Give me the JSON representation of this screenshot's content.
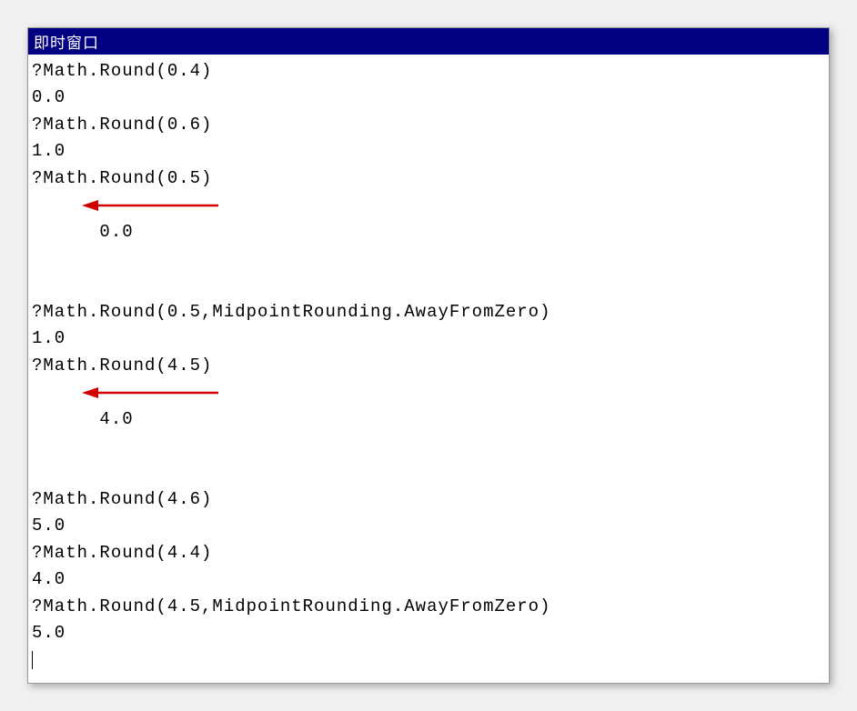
{
  "window": {
    "title": "即时窗口"
  },
  "lines": [
    "?Math.Round(0.4)",
    "0.0",
    "?Math.Round(0.6)",
    "1.0",
    "?Math.Round(0.5)",
    "0.0",
    "?Math.Round(0.5,MidpointRounding.AwayFromZero)",
    "1.0",
    "?Math.Round(4.5)",
    "4.0",
    "?Math.Round(4.6)",
    "5.0",
    "?Math.Round(4.4)",
    "4.0",
    "?Math.Round(4.5,MidpointRounding.AwayFromZero)",
    "5.0"
  ],
  "annotations": {
    "arrow1_target_line_index": 5,
    "arrow2_target_line_index": 9
  }
}
